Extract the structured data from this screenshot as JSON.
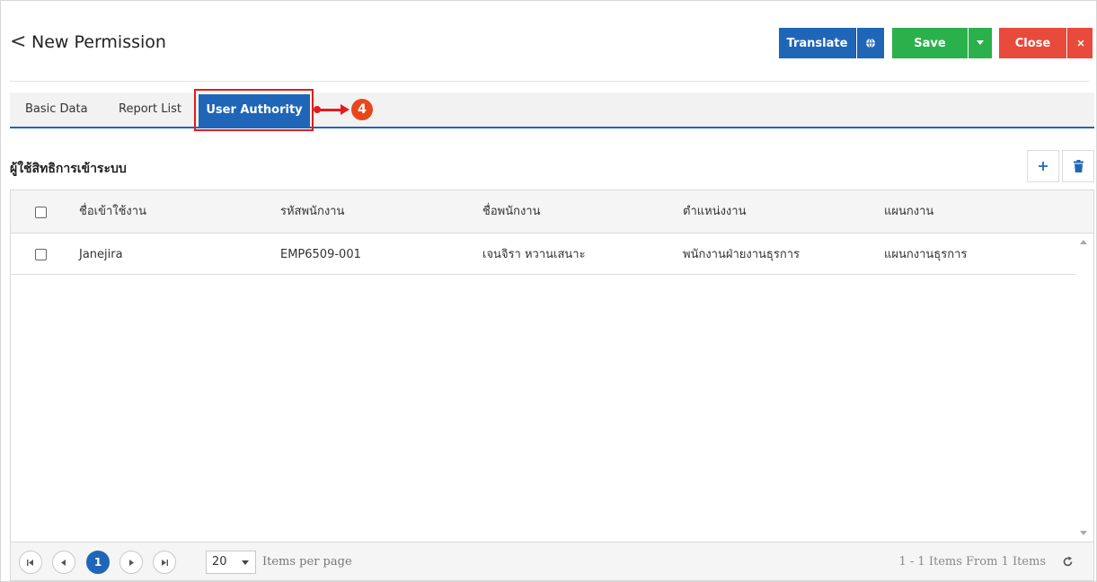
{
  "header": {
    "back_glyph": "<",
    "title": "New Permission",
    "buttons": {
      "translate": "Translate",
      "save": "Save",
      "close": "Close"
    }
  },
  "tabs": [
    {
      "label": "Basic Data",
      "active": false
    },
    {
      "label": "Report List",
      "active": false
    },
    {
      "label": "User Authority",
      "active": true
    }
  ],
  "annotation": {
    "step": "4",
    "color": "#e31b1b"
  },
  "section": {
    "title": "ผู้ใช้สิทธิการเข้าระบบ"
  },
  "grid": {
    "columns": [
      "ชื่อเข้าใช้งาน",
      "รหัสพนักงาน",
      "ชื่อพนักงาน",
      "ตำแหน่งงาน",
      "แผนกงาน"
    ],
    "rows": [
      [
        "Janejira",
        "EMP6509-001",
        "เจนจิรา หวานเสนาะ",
        "พนักงานฝ่ายงานธุรการ",
        "แผนกงานธุรการ"
      ]
    ]
  },
  "pager": {
    "current_page": "1",
    "page_size": "20",
    "per_page_label": "Items per page",
    "items_info": "1 - 1 Items From 1 Items"
  },
  "colors": {
    "primary": "#1f66b8",
    "success": "#2ab14c",
    "danger": "#e84a3c"
  }
}
